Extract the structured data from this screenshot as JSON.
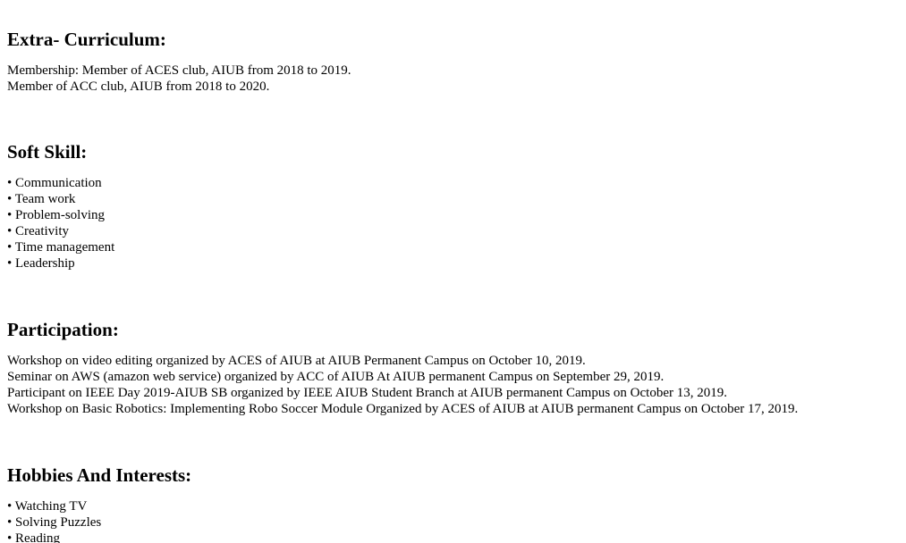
{
  "extra_curriculum": {
    "heading": "Extra- Curriculum:",
    "lines": [
      "Membership: Member of ACES club, AIUB from 2018 to 2019.",
      "Member of ACC club, AIUB from 2018 to 2020."
    ]
  },
  "soft_skill": {
    "heading": "Soft Skill:",
    "items": [
      "• Communication",
      "• Team work",
      "• Problem-solving",
      "• Creativity",
      "• Time management",
      "• Leadership"
    ]
  },
  "participation": {
    "heading": "Participation:",
    "lines": [
      "Workshop on video editing organized by ACES of AIUB at AIUB Permanent Campus on October 10, 2019.",
      "Seminar on AWS (amazon web service) organized by ACC of AIUB At AIUB permanent Campus on September 29, 2019.",
      "Participant on IEEE Day 2019-AIUB SB organized by IEEE AIUB Student Branch at AIUB permanent Campus on October 13, 2019.",
      "Workshop on Basic Robotics: Implementing Robo Soccer Module Organized by ACES of AIUB at AIUB permanent Campus on October 17, 2019."
    ]
  },
  "hobbies": {
    "heading": "Hobbies And Interests:",
    "items": [
      "• Watching TV",
      "• Solving Puzzles",
      "• Reading"
    ]
  }
}
